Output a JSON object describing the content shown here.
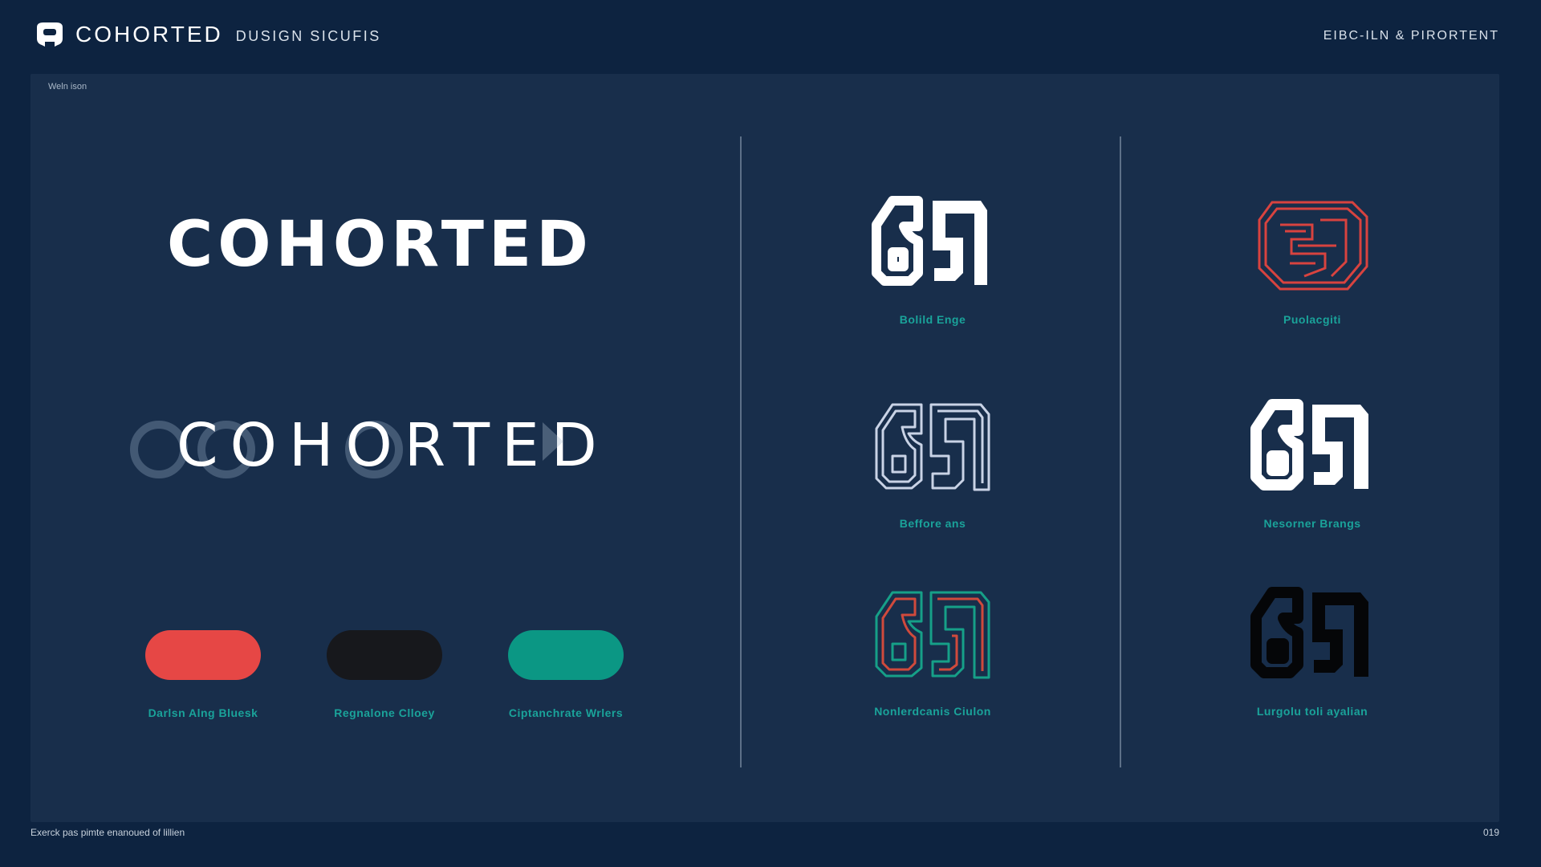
{
  "header": {
    "brand_name": "COHORTED",
    "brand_sub": "DUSIGN SICUFIS",
    "right_text": "EIBC-ILN & PIRORTENT"
  },
  "panel": {
    "label": "Weln ison",
    "wordmark_bold": "COHORTED",
    "wordmark_light": "COHORTED"
  },
  "swatches": [
    {
      "label": "Darlsn Alng Bluesk",
      "color": "#e64745"
    },
    {
      "label": "Regnalone Clloey",
      "color": "#17181c"
    },
    {
      "label": "Ciptanchrate Wrlers",
      "color": "#0b9784"
    }
  ],
  "logos": [
    {
      "label": "Bolild Enge",
      "style": "solid-white"
    },
    {
      "label": "Puolacgiti",
      "style": "outline-red"
    },
    {
      "label": "Beffore ans",
      "style": "outline-lightgray"
    },
    {
      "label": "Nesorner Brangs",
      "style": "solid-white"
    },
    {
      "label": "Nonlerdcanis Ciulon",
      "style": "outline-green-red"
    },
    {
      "label": "Lurgolu toli ayalian",
      "style": "solid-black"
    }
  ],
  "footer": {
    "left_text": "Exerck pas pimte enanoued of lillien",
    "page_number": "019"
  },
  "colors": {
    "background": "#0d2340",
    "panel": "#182e4b",
    "accent_teal": "#1aa39a",
    "accent_red": "#e64745"
  }
}
